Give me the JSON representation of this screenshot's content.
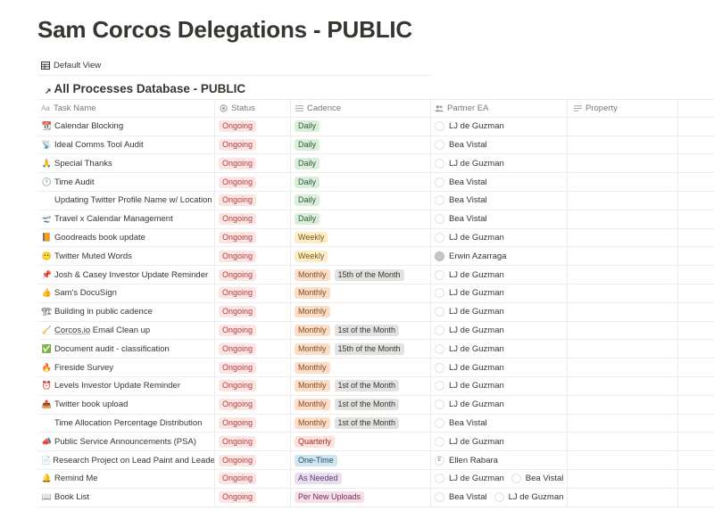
{
  "page": {
    "title": "Sam Corcos Delegations - PUBLIC"
  },
  "view": {
    "label": "Default View",
    "icon": "table-icon"
  },
  "database": {
    "title": "All Processes Database - PUBLIC",
    "icon": "linked-arrow-icon"
  },
  "columns": [
    {
      "label": "Task Name",
      "icon": "text-type-icon"
    },
    {
      "label": "Status",
      "icon": "status-icon"
    },
    {
      "label": "Cadence",
      "icon": "list-icon"
    },
    {
      "label": "Partner EA",
      "icon": "people-icon"
    },
    {
      "label": "Property",
      "icon": "lines-icon"
    }
  ],
  "colors": {
    "ongoing": "#fbe4e4",
    "daily": "#dbeddb",
    "weekly": "#fdecc8",
    "monthly": "#fadec9",
    "quarterly": "#ffe2dd",
    "onetime": "#d3e5ef",
    "asneeded": "#e8deee",
    "perupload": "#f5e0e9"
  },
  "rows": [
    {
      "emoji": "📆",
      "task": "Calendar Blocking",
      "status": "Ongoing",
      "cadence": [
        "Daily"
      ],
      "eas": [
        {
          "name": "LJ de Guzman"
        }
      ]
    },
    {
      "emoji": "📡",
      "task": "Ideal Comms Tool Audit",
      "status": "Ongoing",
      "cadence": [
        "Daily"
      ],
      "eas": [
        {
          "name": "Bea Vistal"
        }
      ]
    },
    {
      "emoji": "🙏",
      "task": "Special Thanks",
      "status": "Ongoing",
      "cadence": [
        "Daily"
      ],
      "eas": [
        {
          "name": "LJ de Guzman"
        }
      ]
    },
    {
      "emoji": "🕛",
      "task": "Time Audit",
      "status": "Ongoing",
      "cadence": [
        "Daily"
      ],
      "eas": [
        {
          "name": "Bea Vistal"
        }
      ]
    },
    {
      "emoji": "",
      "task": "Updating Twitter Profile Name w/ Location",
      "status": "Ongoing",
      "cadence": [
        "Daily"
      ],
      "eas": [
        {
          "name": "Bea Vistal"
        }
      ]
    },
    {
      "emoji": "🛫",
      "task": "Travel x Calendar Management",
      "status": "Ongoing",
      "cadence": [
        "Daily"
      ],
      "eas": [
        {
          "name": "Bea Vistal"
        }
      ]
    },
    {
      "emoji": "📙",
      "task": "Goodreads book update",
      "status": "Ongoing",
      "cadence": [
        "Weekly"
      ],
      "eas": [
        {
          "name": "LJ de Guzman"
        }
      ]
    },
    {
      "emoji": "😶",
      "task": "Twitter Muted Words",
      "status": "Ongoing",
      "cadence": [
        "Weekly"
      ],
      "eas": [
        {
          "name": "Erwin Azarraga"
        }
      ]
    },
    {
      "emoji": "📌",
      "task": "Josh & Casey Investor Update Reminder",
      "status": "Ongoing",
      "cadence": [
        "Monthly",
        "15th of the Month"
      ],
      "eas": [
        {
          "name": "LJ de Guzman"
        }
      ]
    },
    {
      "emoji": "👍",
      "task": "Sam's DocuSign",
      "status": "Ongoing",
      "cadence": [
        "Monthly"
      ],
      "eas": [
        {
          "name": "LJ de Guzman"
        }
      ]
    },
    {
      "emoji": "🏗",
      "task": "Building in public cadence",
      "status": "Ongoing",
      "cadence": [
        "Monthly"
      ],
      "eas": [
        {
          "name": "LJ de Guzman"
        }
      ]
    },
    {
      "emoji": "🧹",
      "task_link": "Corcos.io",
      "task": " Email Clean up",
      "status": "Ongoing",
      "cadence": [
        "Monthly",
        "1st of the Month"
      ],
      "eas": [
        {
          "name": "LJ de Guzman"
        }
      ]
    },
    {
      "emoji": "✅",
      "task": "Document audit - classification",
      "status": "Ongoing",
      "cadence": [
        "Monthly",
        "15th of the Month"
      ],
      "eas": [
        {
          "name": "LJ de Guzman"
        }
      ]
    },
    {
      "emoji": "🔥",
      "task": "Fireside Survey",
      "status": "Ongoing",
      "cadence": [
        "Monthly"
      ],
      "eas": [
        {
          "name": "LJ de Guzman"
        }
      ]
    },
    {
      "emoji": "⏰",
      "task": "Levels Investor Update Reminder",
      "status": "Ongoing",
      "cadence": [
        "Monthly",
        "1st of the Month"
      ],
      "eas": [
        {
          "name": "LJ de Guzman"
        }
      ]
    },
    {
      "emoji": "📤",
      "task": "Twitter book upload",
      "status": "Ongoing",
      "cadence": [
        "Monthly",
        "1st of the Month"
      ],
      "eas": [
        {
          "name": "LJ de Guzman"
        }
      ]
    },
    {
      "emoji": "",
      "task": "Time Allocation Percentage Distribution",
      "status": "Ongoing",
      "cadence": [
        "Monthly",
        "1st of the Month"
      ],
      "eas": [
        {
          "name": "Bea Vistal"
        }
      ]
    },
    {
      "emoji": "📣",
      "task": "Public Service Announcements (PSA)",
      "status": "Ongoing",
      "cadence": [
        "Quarterly"
      ],
      "eas": [
        {
          "name": "LJ de Guzman"
        }
      ]
    },
    {
      "emoji": "📄",
      "task": "Research Project on Lead Paint and Leaded",
      "status": "Ongoing",
      "cadence": [
        "One-Time"
      ],
      "eas": [
        {
          "name": "Ellen Rabara",
          "initial": "E"
        }
      ]
    },
    {
      "emoji": "🔔",
      "task": "Remind Me",
      "status": "Ongoing",
      "cadence": [
        "As Needed"
      ],
      "eas": [
        {
          "name": "LJ de Guzman"
        },
        {
          "name": "Bea Vistal"
        }
      ]
    },
    {
      "emoji": "📖",
      "task": "Book List",
      "status": "Ongoing",
      "cadence": [
        "Per New Uploads"
      ],
      "eas": [
        {
          "name": "Bea Vistal"
        },
        {
          "name": "LJ de Guzman"
        }
      ]
    }
  ]
}
